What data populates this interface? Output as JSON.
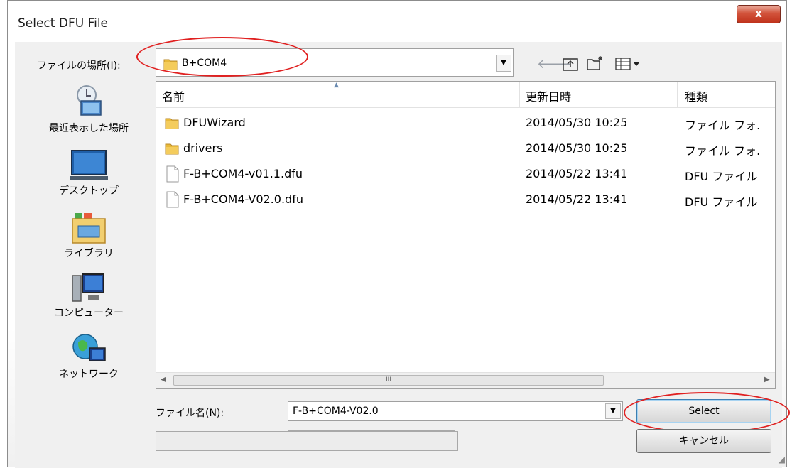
{
  "window": {
    "title": "Select DFU File",
    "close_label": "x"
  },
  "location": {
    "label": "ファイルの場所(I):",
    "value": "B+COM4"
  },
  "toolbar": {
    "back_icon": "back-arrow-icon",
    "up_icon": "up-folder-icon",
    "new_folder_icon": "new-folder-icon",
    "view_icon": "view-menu-icon"
  },
  "places": [
    {
      "label": "最近表示した場所",
      "icon": "recent-places-icon"
    },
    {
      "label": "デスクトップ",
      "icon": "desktop-icon"
    },
    {
      "label": "ライブラリ",
      "icon": "libraries-icon"
    },
    {
      "label": "コンピューター",
      "icon": "computer-icon"
    },
    {
      "label": "ネットワーク",
      "icon": "network-icon"
    }
  ],
  "columns": {
    "name": "名前",
    "date": "更新日時",
    "type": "種類"
  },
  "files": [
    {
      "name": "DFUWizard",
      "date": "2014/05/30 10:25",
      "type": "ファイル フォ.",
      "kind": "folder"
    },
    {
      "name": "drivers",
      "date": "2014/05/30 10:25",
      "type": "ファイル フォ.",
      "kind": "folder"
    },
    {
      "name": "F-B+COM4-v01.1.dfu",
      "date": "2014/05/22 13:41",
      "type": "DFU ファイル",
      "kind": "file"
    },
    {
      "name": "F-B+COM4-V02.0.dfu",
      "date": "2014/05/22 13:41",
      "type": "DFU ファイル",
      "kind": "file"
    }
  ],
  "scroll": {
    "thumb_grip": "III"
  },
  "filename": {
    "label": "ファイル名(N):",
    "value": "F-B+COM4-V02.0"
  },
  "buttons": {
    "select": "Select",
    "cancel": "キャンセル"
  },
  "colors": {
    "annotation_red": "#e02020",
    "close_red": "#c0331c"
  }
}
